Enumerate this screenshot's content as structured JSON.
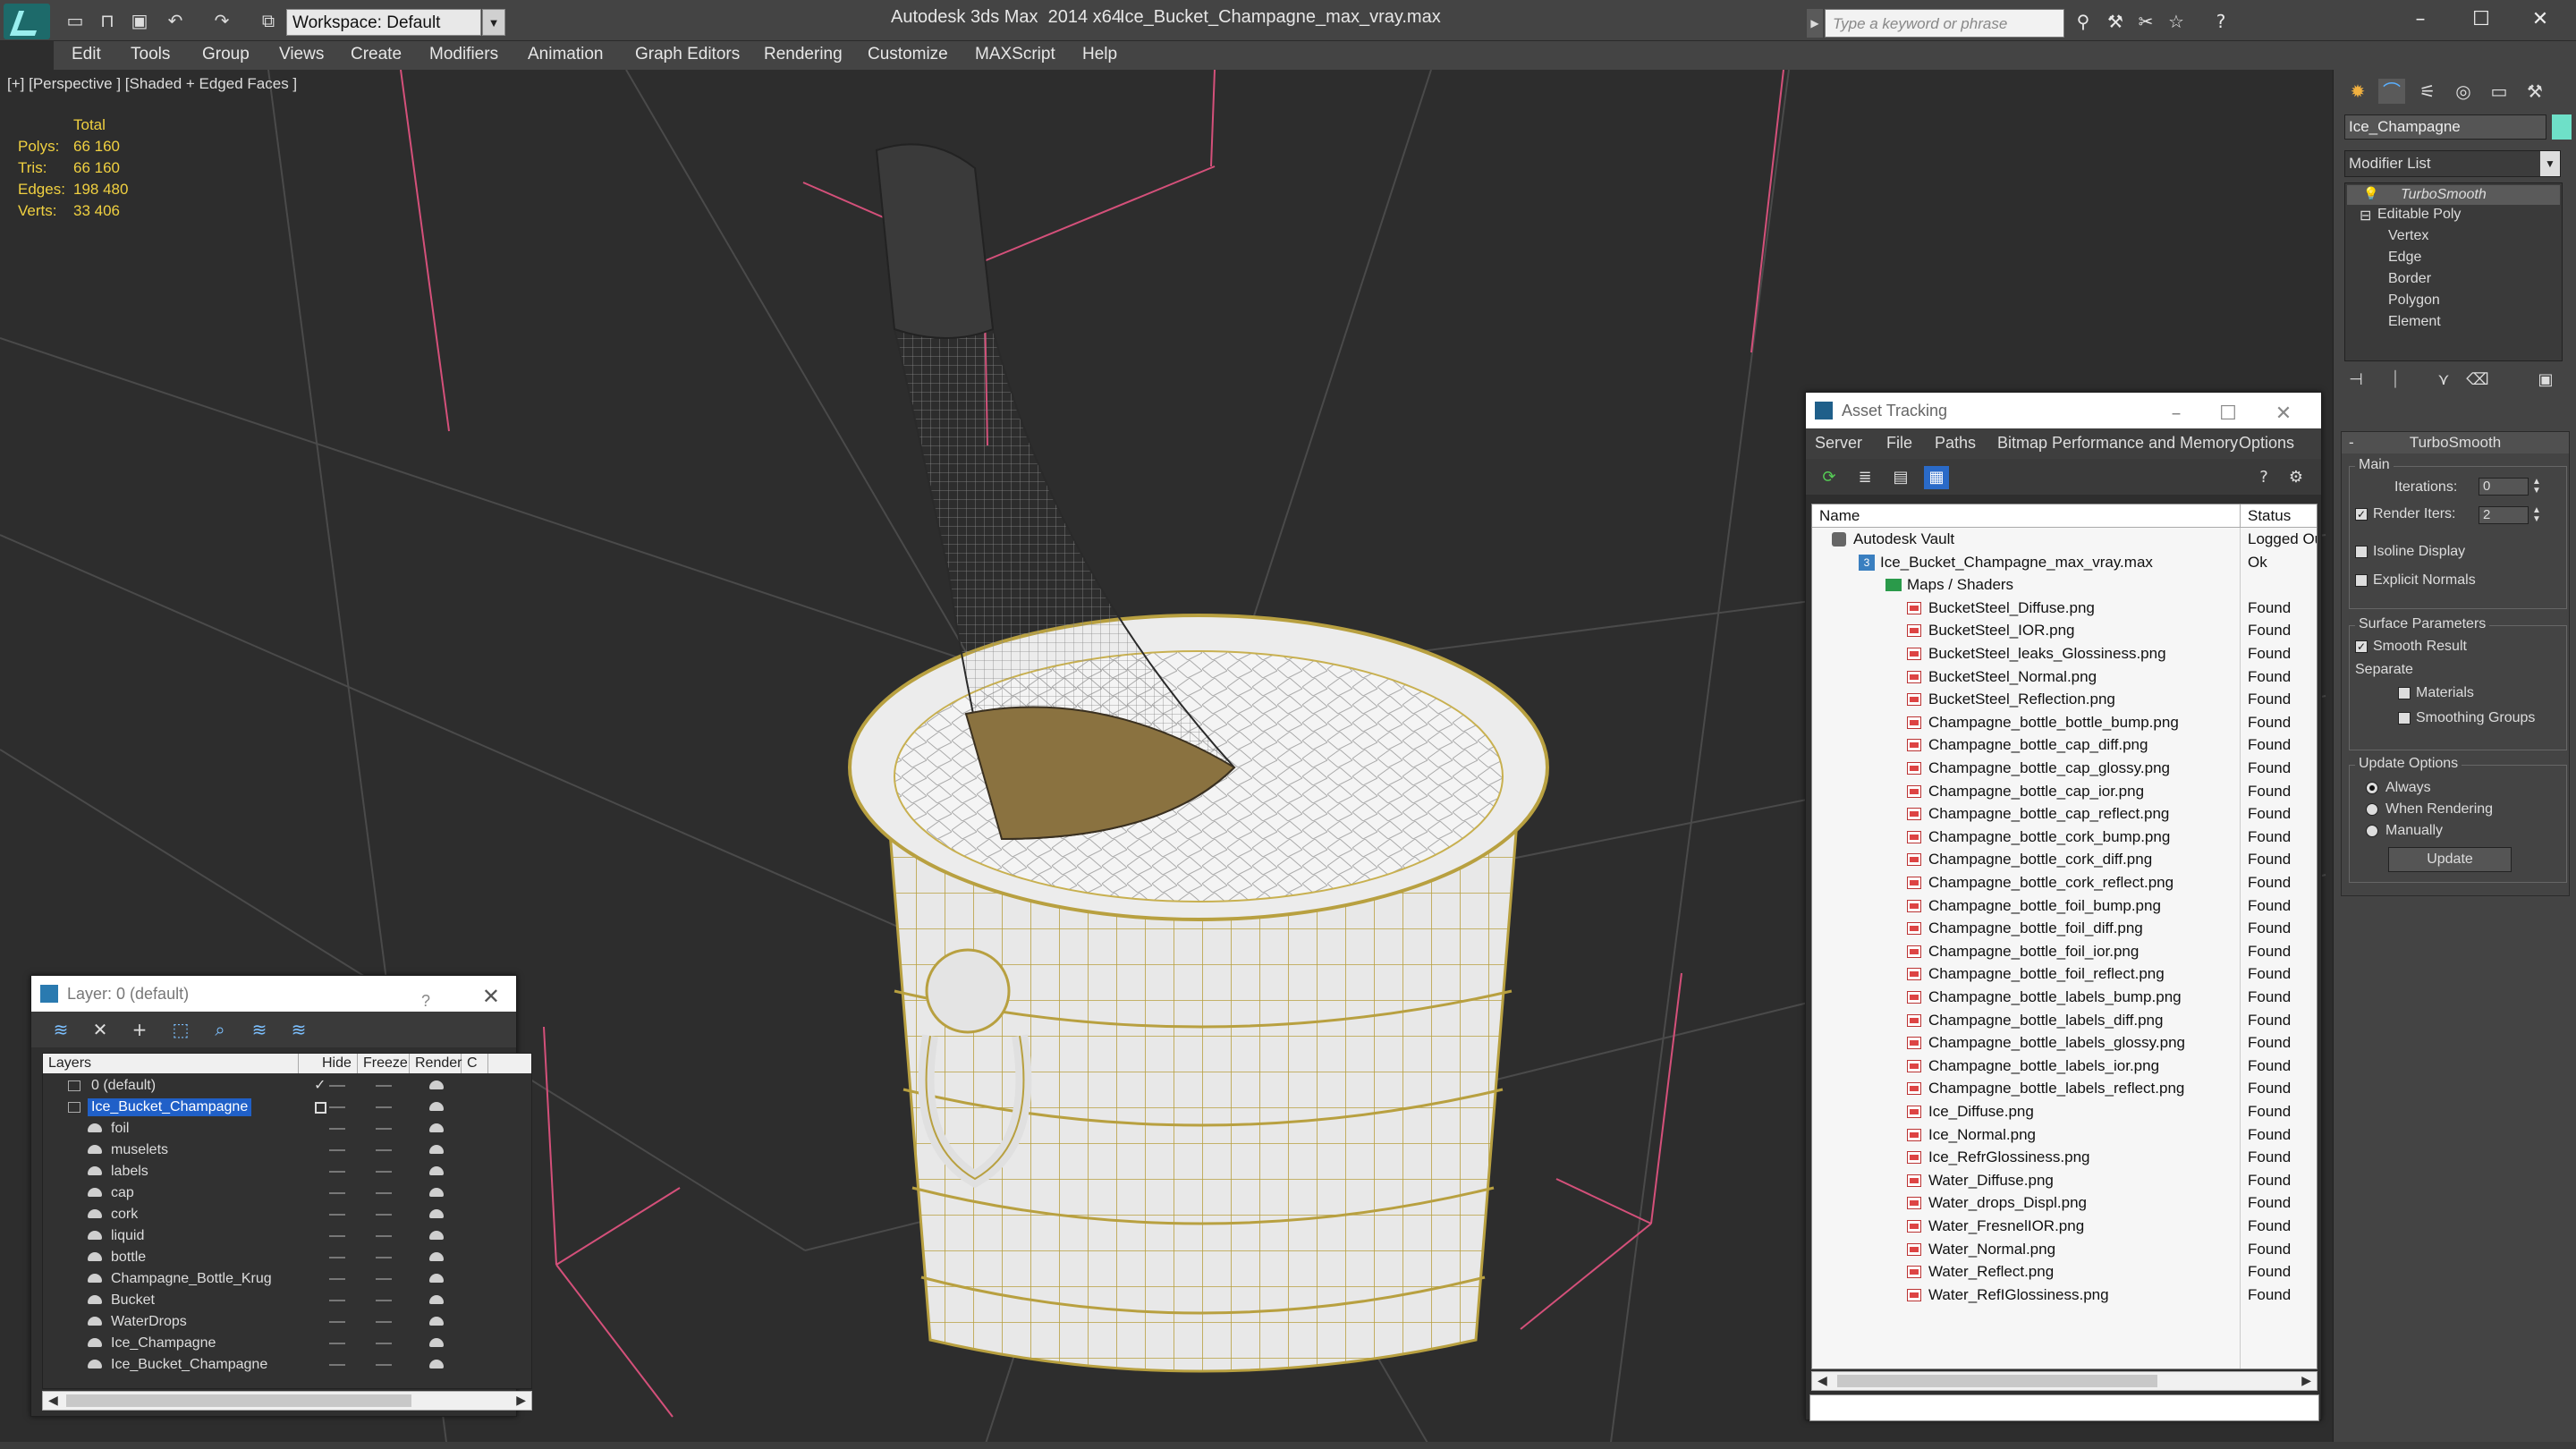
{
  "titlebar": {
    "app_name": "Autodesk 3ds Max  2014 x64",
    "document": "Ice_Bucket_Champagne_max_vray.max",
    "workspace": "Workspace: Default",
    "search_placeholder": "Type a keyword or phrase"
  },
  "menu": [
    "Edit",
    "Tools",
    "Group",
    "Views",
    "Create",
    "Modifiers",
    "Animation",
    "Graph Editors",
    "Rendering",
    "Customize",
    "MAXScript",
    "Help"
  ],
  "viewport": {
    "label": "[+] [Perspective ] [Shaded + Edged Faces ]",
    "stats": {
      "total_label": "Total",
      "rows": [
        {
          "key": "Polys:",
          "value": "66 160"
        },
        {
          "key": "Tris:",
          "value": "66 160"
        },
        {
          "key": "Edges:",
          "value": "198 480"
        },
        {
          "key": "Verts:",
          "value": "33 406"
        }
      ]
    }
  },
  "layer_window": {
    "title": "Layer: 0 (default)",
    "help": "?",
    "columns": [
      "Layers",
      "Hide",
      "Freeze",
      "Render",
      "C"
    ],
    "rows": [
      {
        "name": "0 (default)",
        "level": 0,
        "active": true
      },
      {
        "name": "Ice_Bucket_Champagne",
        "level": 0,
        "selected": true
      },
      {
        "name": "foil",
        "level": 1
      },
      {
        "name": "muselets",
        "level": 1
      },
      {
        "name": "labels",
        "level": 1
      },
      {
        "name": "cap",
        "level": 1
      },
      {
        "name": "cork",
        "level": 1
      },
      {
        "name": "liquid",
        "level": 1
      },
      {
        "name": "bottle",
        "level": 1
      },
      {
        "name": "Champagne_Bottle_Krug",
        "level": 1
      },
      {
        "name": "Bucket",
        "level": 1
      },
      {
        "name": "WaterDrops",
        "level": 1
      },
      {
        "name": "Ice_Champagne",
        "level": 1
      },
      {
        "name": "Ice_Bucket_Champagne",
        "level": 1
      }
    ]
  },
  "asset_tracking": {
    "title": "Asset Tracking",
    "menu": [
      "Server",
      "File",
      "Paths",
      "Bitmap Performance and Memory",
      "Options"
    ],
    "columns": [
      "Name",
      "Status"
    ],
    "rows": [
      {
        "name": "Autodesk Vault",
        "status": "Logged Out",
        "kind": "vault",
        "indent": 0
      },
      {
        "name": "Ice_Bucket_Champagne_max_vray.max",
        "status": "Ok",
        "kind": "max",
        "indent": 1
      },
      {
        "name": "Maps / Shaders",
        "status": "",
        "kind": "folder",
        "indent": 2
      },
      {
        "name": "BucketSteel_Diffuse.png",
        "status": "Found",
        "kind": "png",
        "indent": 3
      },
      {
        "name": "BucketSteel_IOR.png",
        "status": "Found",
        "kind": "png",
        "indent": 3
      },
      {
        "name": "BucketSteel_leaks_Glossiness.png",
        "status": "Found",
        "kind": "png",
        "indent": 3
      },
      {
        "name": "BucketSteel_Normal.png",
        "status": "Found",
        "kind": "png",
        "indent": 3
      },
      {
        "name": "BucketSteel_Reflection.png",
        "status": "Found",
        "kind": "png",
        "indent": 3
      },
      {
        "name": "Champagne_bottle_bottle_bump.png",
        "status": "Found",
        "kind": "png",
        "indent": 3
      },
      {
        "name": "Champagne_bottle_cap_diff.png",
        "status": "Found",
        "kind": "png",
        "indent": 3
      },
      {
        "name": "Champagne_bottle_cap_glossy.png",
        "status": "Found",
        "kind": "png",
        "indent": 3
      },
      {
        "name": "Champagne_bottle_cap_ior.png",
        "status": "Found",
        "kind": "png",
        "indent": 3
      },
      {
        "name": "Champagne_bottle_cap_reflect.png",
        "status": "Found",
        "kind": "png",
        "indent": 3
      },
      {
        "name": "Champagne_bottle_cork_bump.png",
        "status": "Found",
        "kind": "png",
        "indent": 3
      },
      {
        "name": "Champagne_bottle_cork_diff.png",
        "status": "Found",
        "kind": "png",
        "indent": 3
      },
      {
        "name": "Champagne_bottle_cork_reflect.png",
        "status": "Found",
        "kind": "png",
        "indent": 3
      },
      {
        "name": "Champagne_bottle_foil_bump.png",
        "status": "Found",
        "kind": "png",
        "indent": 3
      },
      {
        "name": "Champagne_bottle_foil_diff.png",
        "status": "Found",
        "kind": "png",
        "indent": 3
      },
      {
        "name": "Champagne_bottle_foil_ior.png",
        "status": "Found",
        "kind": "png",
        "indent": 3
      },
      {
        "name": "Champagne_bottle_foil_reflect.png",
        "status": "Found",
        "kind": "png",
        "indent": 3
      },
      {
        "name": "Champagne_bottle_labels_bump.png",
        "status": "Found",
        "kind": "png",
        "indent": 3
      },
      {
        "name": "Champagne_bottle_labels_diff.png",
        "status": "Found",
        "kind": "png",
        "indent": 3
      },
      {
        "name": "Champagne_bottle_labels_glossy.png",
        "status": "Found",
        "kind": "png",
        "indent": 3
      },
      {
        "name": "Champagne_bottle_labels_ior.png",
        "status": "Found",
        "kind": "png",
        "indent": 3
      },
      {
        "name": "Champagne_bottle_labels_reflect.png",
        "status": "Found",
        "kind": "png",
        "indent": 3
      },
      {
        "name": "Ice_Diffuse.png",
        "status": "Found",
        "kind": "png",
        "indent": 3
      },
      {
        "name": "Ice_Normal.png",
        "status": "Found",
        "kind": "png",
        "indent": 3
      },
      {
        "name": "Ice_RefrGlossiness.png",
        "status": "Found",
        "kind": "png",
        "indent": 3
      },
      {
        "name": "Water_Diffuse.png",
        "status": "Found",
        "kind": "png",
        "indent": 3
      },
      {
        "name": "Water_drops_Displ.png",
        "status": "Found",
        "kind": "png",
        "indent": 3
      },
      {
        "name": "Water_FresnelIOR.png",
        "status": "Found",
        "kind": "png",
        "indent": 3
      },
      {
        "name": "Water_Normal.png",
        "status": "Found",
        "kind": "png",
        "indent": 3
      },
      {
        "name": "Water_Reflect.png",
        "status": "Found",
        "kind": "png",
        "indent": 3
      },
      {
        "name": "Water_RefIGlossiness.png",
        "status": "Found",
        "kind": "png",
        "indent": 3
      }
    ]
  },
  "command_panel": {
    "object_name": "Ice_Champagne",
    "object_color": "#6ee0c8",
    "modifier_list": "Modifier List",
    "stack": {
      "selected": "TurboSmooth",
      "base": "Editable Poly",
      "subobjects": [
        "Vertex",
        "Edge",
        "Border",
        "Polygon",
        "Element"
      ]
    },
    "turbosmooth": {
      "title": "TurboSmooth",
      "main_label": "Main",
      "iterations_label": "Iterations:",
      "iterations_value": "0",
      "render_iters_label": "Render Iters:",
      "render_iters_value": "2",
      "render_iters_checked": true,
      "isoline_label": "Isoline Display",
      "explicit_normals_label": "Explicit Normals",
      "surface_label": "Surface Parameters",
      "smooth_result_label": "Smooth Result",
      "separate_label": "Separate",
      "materials_label": "Materials",
      "smoothing_groups_label": "Smoothing Groups",
      "update_options_label": "Update Options",
      "always_label": "Always",
      "when_rendering_label": "When Rendering",
      "manually_label": "Manually",
      "update_button": "Update"
    }
  }
}
